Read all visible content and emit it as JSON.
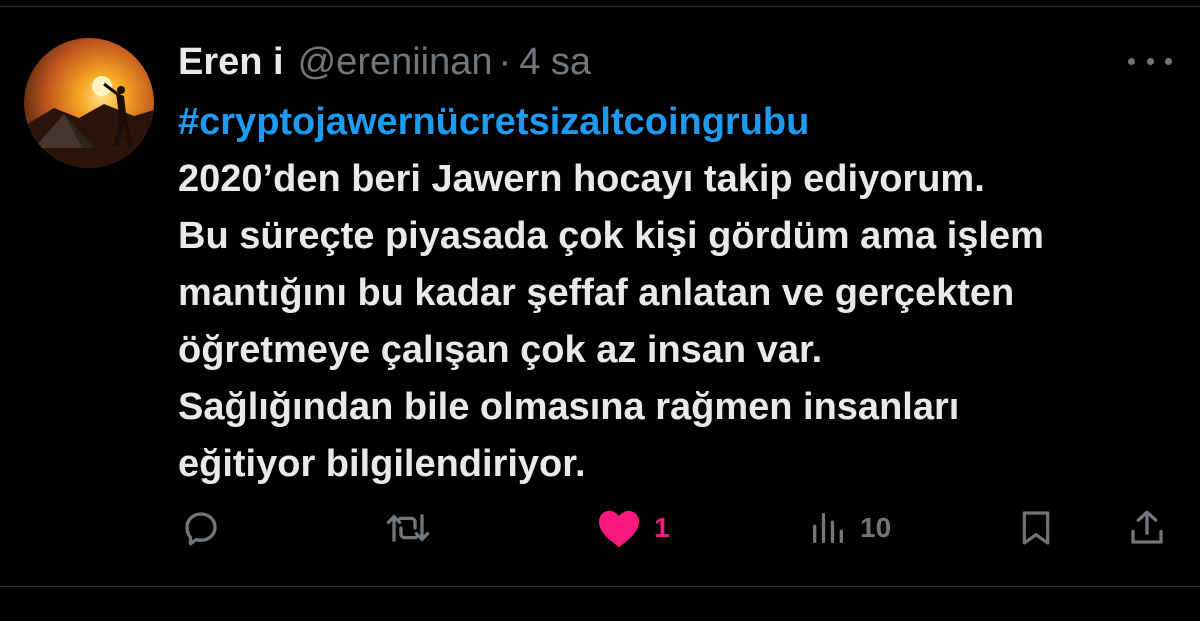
{
  "tweet": {
    "author": {
      "display_name": "Eren i",
      "handle": "@ereniinan",
      "separator": "·",
      "time": "4 sa"
    },
    "hashtag": "#cryptojawernücretsizaltcoingrubu",
    "lines": [
      "2020’den beri Jawern hocayı takip ediyorum.",
      "Bu süreçte piyasada çok kişi gördüm ama işlem",
      "mantığını bu kadar şeffaf anlatan ve gerçekten",
      "öğretmeye çalışan çok az insan var.",
      "Sağlığından bile olmasına rağmen insanları",
      "eğitiyor bilgilendiriyor."
    ],
    "actions": {
      "reply_icon": "reply-icon",
      "retweet_icon": "retweet-icon",
      "like_icon": "heart-filled-icon",
      "like_count": "1",
      "views_icon": "bar-chart-icon",
      "views_count": "10",
      "bookmark_icon": "bookmark-icon",
      "share_icon": "share-icon"
    }
  },
  "colors": {
    "background": "#000000",
    "text": "#e7e9ea",
    "muted": "#71767b",
    "link": "#1d9bf0",
    "like": "#f91880"
  }
}
